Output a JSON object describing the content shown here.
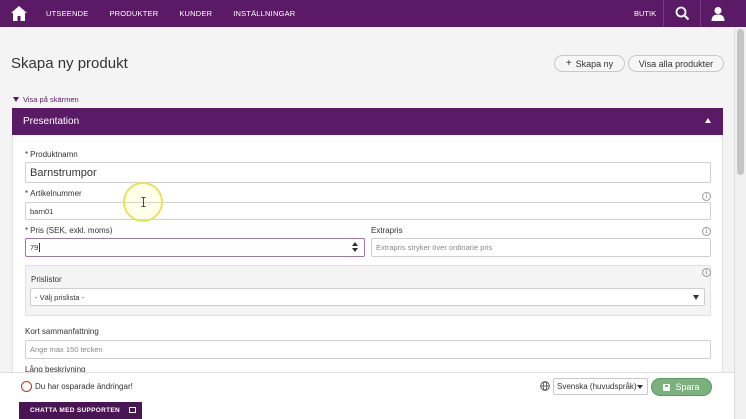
{
  "topnav": {
    "menu": [
      "UTSEENDE",
      "PRODUKTER",
      "KUNDER",
      "INSTÄLLNINGAR"
    ],
    "shop": "BUTIK"
  },
  "page": {
    "title": "Skapa ny produkt",
    "create_new": "Skapa ny",
    "view_all": "Visa alla produkter",
    "show_on_screen": "Visa på skärmen"
  },
  "panel": {
    "title": "Presentation",
    "product_name": {
      "label": "Produktnamn",
      "value": "Barnstrumpor"
    },
    "article_number": {
      "label": "Artikelnummer",
      "value": "barn01"
    },
    "price": {
      "label": "Pris (SEK, exkl. moms)",
      "value": "79"
    },
    "extra_price": {
      "label": "Extrapris",
      "placeholder": "Extrapris stryker över ordinarie pris"
    },
    "price_lists": {
      "label": "Prislistor",
      "selected": "- Välj prislista -"
    },
    "short_summary": {
      "label": "Kort sammanfattning",
      "placeholder": "Ange max 150 tecken"
    },
    "long_description": {
      "label": "Lång beskrivning"
    }
  },
  "footer": {
    "unsaved_changes": "Du har osparade ändringar!",
    "language": "Svenska (huvudspråk)",
    "save": "Spara",
    "chat": "CHATTA MED SUPPORTEN"
  },
  "colors": {
    "brand": "#5b1a66",
    "save": "#7ab17d",
    "unsaved": "#c62828"
  }
}
